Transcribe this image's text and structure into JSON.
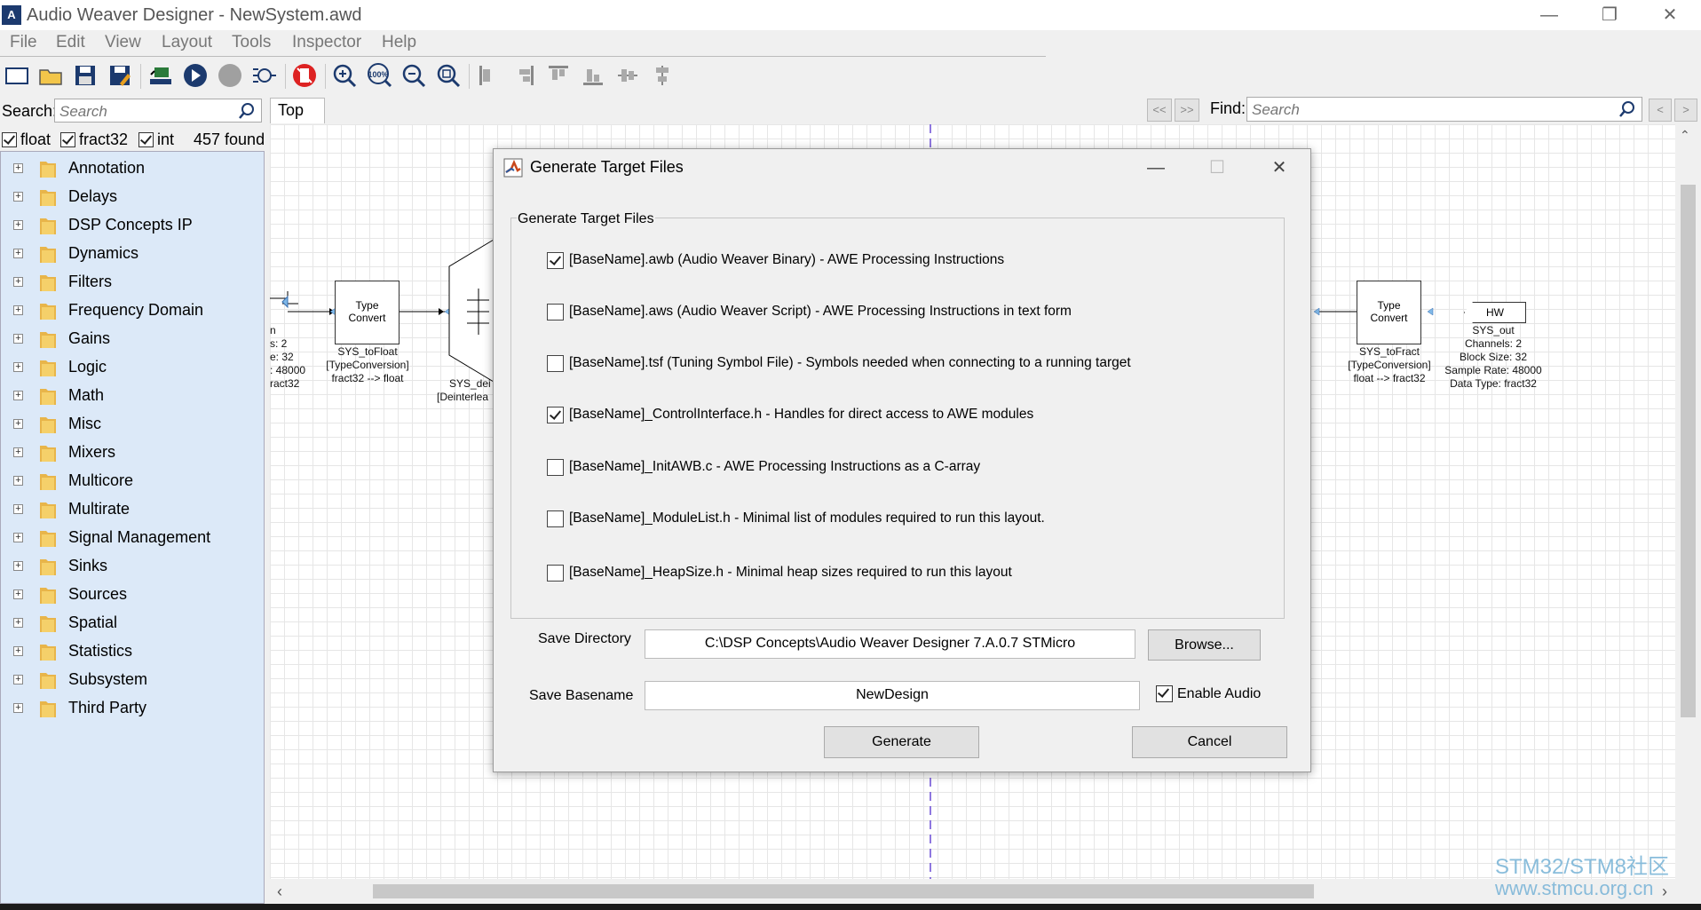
{
  "window": {
    "title": "Audio Weaver Designer - NewSystem.awd",
    "logo_text": "A"
  },
  "menu": [
    "File",
    "Edit",
    "View",
    "Layout",
    "Tools",
    "Inspector",
    "Help"
  ],
  "toolbar": {
    "icons": [
      "new-file-icon",
      "open-folder-icon",
      "save-icon",
      "save-as-icon",
      "connect-target-icon",
      "run-icon",
      "stop-icon",
      "build-icon",
      "profile-icon",
      "zoom-in-icon",
      "zoom-100-icon",
      "zoom-out-icon",
      "zoom-fit-icon",
      "align-left-icon",
      "align-right-icon",
      "align-top-icon",
      "align-bottom-icon",
      "align-center-h-icon",
      "align-center-v-icon"
    ],
    "zoom_100_text": "100%"
  },
  "left_panel": {
    "search_label": "Search:",
    "search_placeholder": "Search",
    "filters": [
      {
        "label": "float",
        "checked": true
      },
      {
        "label": "fract32",
        "checked": true
      },
      {
        "label": "int",
        "checked": true
      }
    ],
    "found_count": "457 found",
    "tree": [
      "Annotation",
      "Delays",
      "DSP Concepts IP",
      "Dynamics",
      "Filters",
      "Frequency Domain",
      "Gains",
      "Logic",
      "Math",
      "Misc",
      "Mixers",
      "Multicore",
      "Multirate",
      "Signal Management",
      "Sinks",
      "Sources",
      "Spatial",
      "Statistics",
      "Subsystem",
      "Third Party"
    ]
  },
  "canvas": {
    "tab": "Top",
    "nav_prev": "<<",
    "nav_next": ">>",
    "find_label": "Find:",
    "find_placeholder": "Search",
    "find_prev": "<",
    "find_next": ">",
    "left_block_lines": [
      "n",
      "s: 2",
      "e: 32",
      ": 48000",
      "ract32"
    ],
    "type_convert_label": "Type\nConvert",
    "to_float": {
      "name": "SYS_toFloat",
      "type": "[TypeConversion]",
      "desc": "fract32 --> float"
    },
    "deint": {
      "name": "SYS_dei",
      "type": "[Deinterlea"
    },
    "to_fract": {
      "name": "SYS_toFract",
      "type": "[TypeConversion]",
      "desc": "float --> fract32"
    },
    "hw_label": "HW",
    "sys_out": [
      "SYS_out",
      "Channels: 2",
      "Block Size: 32",
      "Sample Rate: 48000",
      "Data Type: fract32"
    ]
  },
  "dialog": {
    "title": "Generate Target Files",
    "group_label": "Generate Target Files",
    "options": [
      {
        "label": "[BaseName].awb (Audio Weaver Binary) - AWE Processing Instructions",
        "checked": true
      },
      {
        "label": "[BaseName].aws (Audio Weaver Script) - AWE Processing Instructions in text form",
        "checked": false
      },
      {
        "label": "[BaseName].tsf (Tuning Symbol File) - Symbols needed when connecting to a running target",
        "checked": false
      },
      {
        "label": "[BaseName]_ControlInterface.h - Handles for direct access to AWE modules",
        "checked": true
      },
      {
        "label": "[BaseName]_InitAWB.c - AWE Processing Instructions as a C-array",
        "checked": false
      },
      {
        "label": "[BaseName]_ModuleList.h - Minimal list of modules required to run this layout.",
        "checked": false
      },
      {
        "label": "[BaseName]_HeapSize.h - Minimal heap sizes required to run this layout",
        "checked": false
      }
    ],
    "save_directory_label": "Save Directory",
    "save_directory_value": "C:\\DSP Concepts\\Audio Weaver Designer 7.A.0.7 STMicro",
    "browse_label": "Browse...",
    "save_basename_label": "Save Basename",
    "save_basename_value": "NewDesign",
    "enable_audio_label": "Enable Audio",
    "enable_audio_checked": true,
    "generate_label": "Generate",
    "cancel_label": "Cancel"
  },
  "watermark": {
    "line1": "STM32/STM8社区",
    "line2": "www.stmcu.org.cn"
  }
}
